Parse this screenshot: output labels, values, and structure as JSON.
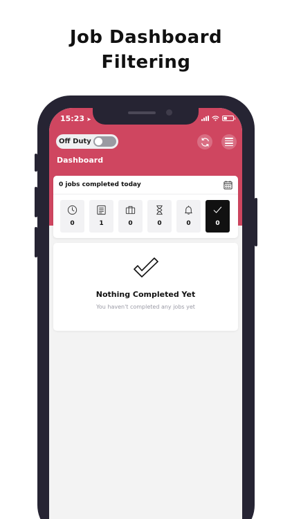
{
  "headline": {
    "line1": "Job Dashboard",
    "line2": "Filtering"
  },
  "status_bar": {
    "time": "15:23"
  },
  "header": {
    "duty_label": "Off Duty",
    "duty_on": false,
    "title": "Dashboard",
    "accent_color": "#cf4660"
  },
  "jobs_card": {
    "summary": "0 jobs completed today",
    "filters": [
      {
        "icon": "clock-icon",
        "count": "0",
        "active": false
      },
      {
        "icon": "list-icon",
        "count": "1",
        "active": false
      },
      {
        "icon": "briefcase-icon",
        "count": "0",
        "active": false
      },
      {
        "icon": "hourglass-icon",
        "count": "0",
        "active": false
      },
      {
        "icon": "bell-icon",
        "count": "0",
        "active": false
      },
      {
        "icon": "checkmark-icon",
        "count": "0",
        "active": true
      }
    ]
  },
  "empty_state": {
    "icon": "checkmark-icon",
    "title": "Nothing Completed Yet",
    "subtitle": "You haven't completed any jobs yet"
  }
}
